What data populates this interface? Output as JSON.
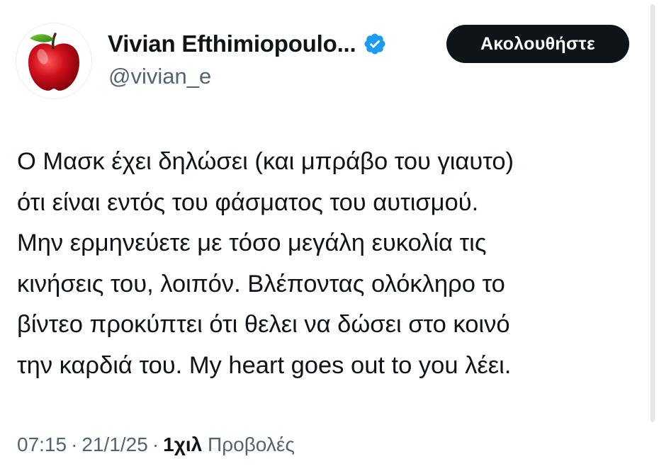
{
  "author": {
    "display_name": "Vivian Efthimiopoulo...",
    "handle": "@vivian_e",
    "verified_icon": "verified-badge-icon",
    "avatar_icon": "red-apple-icon"
  },
  "follow_button": {
    "label": "Ακολουθήστε"
  },
  "tweet": {
    "lines": [
      "Ο Μασκ έχει δηλώσει (και μπράβο του γιαυτο)",
      "ότι είναι εντός του φάσματος του αυτισμού.",
      "Μην ερμηνεύετε με τόσο μεγάλη ευκολία τις",
      "κινήσεις του, λοιπόν. Βλέποντας ολόκληρο το",
      "βίντεο προκύπτει ότι θελει να δώσει στο κοινό",
      "την καρδιά του. My heart goes out to you λέει."
    ]
  },
  "meta": {
    "time": "07:15",
    "separator": "·",
    "date": "21/1/25",
    "views_count": "1χιλ",
    "views_label": "Προβολές"
  },
  "colors": {
    "text_primary": "#0f1419",
    "text_secondary": "#536471",
    "verified_blue": "#1d9bf0",
    "button_bg": "#0f1419",
    "apple_red": "#c8102e"
  }
}
